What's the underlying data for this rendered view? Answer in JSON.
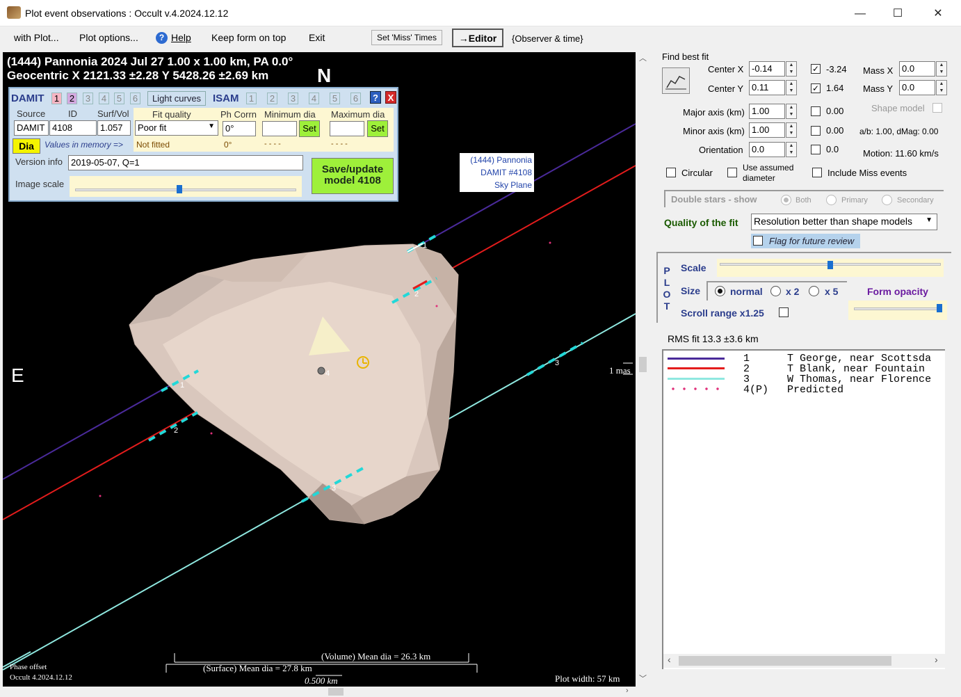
{
  "window": {
    "title": "Plot event observations : Occult v.4.2024.12.12",
    "minimize": "—",
    "maximize": "☐",
    "close": "✕"
  },
  "menu": {
    "with_plot": "with Plot...",
    "plot_options": "Plot options...",
    "help": "Help",
    "keep_on_top": "Keep form on top",
    "exit": "Exit",
    "set_miss_times": "Set 'Miss' Times",
    "editor": "→Editor",
    "observer_time": "{Observer & time}"
  },
  "plot": {
    "header_line1": "(1444) Pannonia  2024 Jul 27   1.00 x 1.00 km, PA 0.0°",
    "header_line2": "Geocentric  X  2121.33 ±2.28  Y 5428.26 ±2.69 km",
    "north": "N",
    "east": "E",
    "sky_label_1": "(1444) Pannonia",
    "sky_label_2": "DAMIT #4108",
    "sky_label_3": "Sky Plane",
    "mas_label": "1 mas",
    "volume_dia": "(Volume) Mean dia = 26.3 km",
    "surface_dia": "(Surface) Mean dia = 27.8 km",
    "scale_km": "0.500 km",
    "phase_offset": "Phase offset",
    "occult_version": "Occult 4.2024.12.12",
    "plot_width": "Plot width: 57 km",
    "chord_labels": [
      "1",
      "2",
      "3",
      "1",
      "2",
      "3",
      "4"
    ]
  },
  "damit_panel": {
    "damit": "DAMIT",
    "model_tabs": [
      "1",
      "2",
      "3",
      "4",
      "5",
      "6"
    ],
    "light_curves": "Light curves",
    "isam": "ISAM",
    "isam_tabs": [
      "1",
      "2",
      "3",
      "4",
      "5",
      "6"
    ],
    "help_btn": "?",
    "close_btn": "X",
    "source_label": "Source",
    "id_label": "ID",
    "surfvol_label": "Surf/Vol",
    "source_value": "DAMIT",
    "id_value": "4108",
    "surfvol_value": "1.057",
    "dia_btn": "Dia",
    "values_in_memory": "Values in memory =>",
    "fit_quality_label": "Fit quality",
    "fit_quality_value": "Poor fit",
    "not_fitted": "Not fitted",
    "ph_corrn_label": "Ph Corrn",
    "ph_corrn_value": "0°",
    "ph_corrn_memory": "0°",
    "min_dia_label": "Minimum dia",
    "max_dia_label": "Maximum dia",
    "set_label": "Set",
    "dashes": "- - - -",
    "version_info_label": "Version info",
    "version_info_value": "2019-05-07, Q=1",
    "image_scale_label": "Image scale",
    "save_update": "Save/update\nmodel 4108"
  },
  "fit_panel": {
    "find_best_fit": "Find best fit",
    "center_x_label": "Center X",
    "center_x_value": "-0.14",
    "center_x_check": "-3.24",
    "center_y_label": "Center Y",
    "center_y_value": "0.11",
    "center_y_check": "1.64",
    "mass_x_label": "Mass X",
    "mass_x_value": "0.0",
    "mass_y_label": "Mass Y",
    "mass_y_value": "0.0",
    "major_axis_label": "Major axis (km)",
    "major_axis_value": "1.00",
    "major_check": "0.00",
    "minor_axis_label": "Minor axis (km)",
    "minor_axis_value": "1.00",
    "minor_check": "0.00",
    "orientation_label": "Orientation",
    "orientation_value": "0.0",
    "orientation_check": "0.0",
    "shape_model": "Shape model",
    "ab_dmag": "a/b: 1.00, dMag: 0.00",
    "motion": "Motion: 11.60 km/s",
    "circular": "Circular",
    "use_assumed": "Use assumed\ndiameter",
    "include_miss": "Include Miss events",
    "double_stars": "Double stars - show",
    "both": "Both",
    "primary": "Primary",
    "secondary": "Secondary",
    "quality_label": "Quality of the fit",
    "quality_value": "Resolution better than shape models",
    "flag_review": "Flag for future review"
  },
  "plot_panel": {
    "plot_letters": [
      "P",
      "L",
      "O",
      "T"
    ],
    "scale": "Scale",
    "size": "Size",
    "normal": "normal",
    "x2": "x 2",
    "x5": "x 5",
    "form_opacity": "Form opacity",
    "scroll_range": "Scroll range x1.25",
    "rms_fit": "RMS fit 13.3 ±3.6 km"
  },
  "legend": {
    "rows": [
      {
        "num": "1",
        "text": "T George, near Scottsda",
        "color": "#4a2a9a"
      },
      {
        "num": "2",
        "text": "T Blank, near Fountain",
        "color": "#e31c1c"
      },
      {
        "num": "3",
        "text": "W Thomas, near Florence",
        "color": "#8fe8e0"
      },
      {
        "num": "4(P)",
        "text": "Predicted",
        "color": "#e0307a"
      }
    ]
  }
}
